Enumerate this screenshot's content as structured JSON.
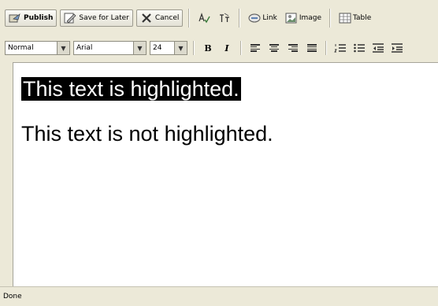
{
  "toolbar": {
    "publish_label": "Publish",
    "save_later_label": "Save for Later",
    "cancel_label": "Cancel",
    "link_label": "Link",
    "image_label": "Image",
    "table_label": "Table"
  },
  "format_bar": {
    "style_value": "Normal",
    "font_value": "Arial",
    "size_value": "24",
    "bold_label": "B",
    "italic_label": "I"
  },
  "editor": {
    "highlighted_text": "This text is highlighted.",
    "plain_text": "This text is not highlighted."
  },
  "status": {
    "text": "Done"
  },
  "colors": {
    "chrome": "#ece9d8",
    "highlight_bg": "#000000",
    "highlight_fg": "#ffffff"
  }
}
